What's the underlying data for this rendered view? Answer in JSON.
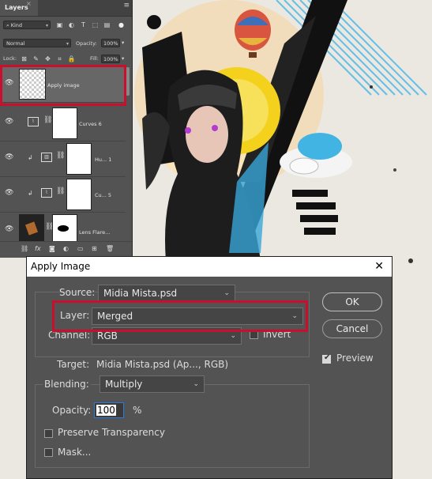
{
  "layers_panel": {
    "tab": "Layers",
    "filter": {
      "kind": "Kind"
    },
    "blend_mode": "Normal",
    "opacity_label": "Opacity:",
    "opacity_value": "100%",
    "lock_label": "Lock:",
    "fill_label": "Fill:",
    "fill_value": "100%",
    "layers": [
      {
        "name": "Apply image"
      },
      {
        "name": "Curves 6"
      },
      {
        "name": "Hu... 1"
      },
      {
        "name": "Cu... 5"
      },
      {
        "name": "Lens Flare..."
      }
    ],
    "footer": {
      "fx": "fx"
    }
  },
  "dialog": {
    "title": "Apply Image",
    "source_label": "Source:",
    "source_value": "Midia Mista.psd",
    "layer_label": "Layer:",
    "layer_value": "Merged",
    "channel_label": "Channel:",
    "channel_value": "RGB",
    "invert_label": "Invert",
    "invert_checked": false,
    "target_label": "Target:",
    "target_value": "Midia Mista.psd (Ap..., RGB)",
    "blending_label": "Blending:",
    "blending_value": "Multiply",
    "opacity_label": "Opacity:",
    "opacity_value": "100",
    "opacity_unit": "%",
    "preserve_label": "Preserve Transparency",
    "preserve_checked": false,
    "mask_label": "Mask...",
    "mask_checked": false,
    "ok_label": "OK",
    "cancel_label": "Cancel",
    "preview_label": "Preview",
    "preview_checked": true
  },
  "colors": {
    "highlight_red": "#c8102e",
    "panel_gray": "#535353",
    "accent_blue": "#2d7bd6"
  }
}
